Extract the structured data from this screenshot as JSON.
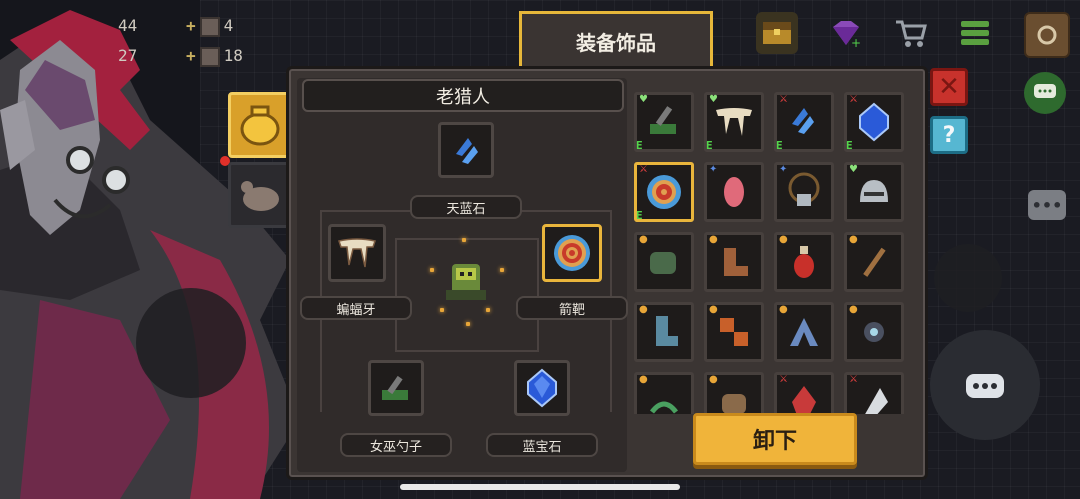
{
  "hud": {
    "stat1_value": "44",
    "stat2_value": "27",
    "plus": "+",
    "stat3_value": "4",
    "stat4_value": "18"
  },
  "header": {
    "title": "装备饰品"
  },
  "equipment": {
    "character_name": "老猎人",
    "slots": [
      {
        "label": "天蓝石",
        "icon": "azure-stone-icon"
      },
      {
        "label": "蝙蝠牙",
        "icon": "bat-fang-icon"
      },
      {
        "label": "箭靶",
        "icon": "target-icon"
      },
      {
        "label": "女巫勺子",
        "icon": "witch-spoon-icon"
      },
      {
        "label": "蓝宝石",
        "icon": "sapphire-icon"
      }
    ]
  },
  "inventory": {
    "equipped_marker": "E",
    "items": [
      {
        "icon": "witch-spoon-icon",
        "tag": "heart",
        "equipped": true
      },
      {
        "icon": "bat-fang-icon",
        "tag": "heart",
        "equipped": true
      },
      {
        "icon": "azure-stone-icon",
        "tag": "sword",
        "equipped": true
      },
      {
        "icon": "sapphire-icon",
        "tag": "sword",
        "equipped": true
      },
      {
        "icon": "target-icon",
        "tag": "sword",
        "equipped": true
      },
      {
        "icon": "pink-crystal-icon",
        "tag": "star",
        "equipped": false
      },
      {
        "icon": "skull-necklace-icon",
        "tag": "star",
        "equipped": false
      },
      {
        "icon": "spiked-helmet-icon",
        "tag": "heart",
        "equipped": false
      },
      {
        "icon": "green-claw-icon",
        "tag": "lock",
        "equipped": false
      },
      {
        "icon": "leather-boot-icon",
        "tag": "lock",
        "equipped": false
      },
      {
        "icon": "potion-icon",
        "tag": "lock",
        "equipped": false
      },
      {
        "icon": "wooden-staff-icon",
        "tag": "lock",
        "equipped": false
      },
      {
        "icon": "blue-boot-icon",
        "tag": "lock",
        "equipped": false
      },
      {
        "icon": "fire-cubes-icon",
        "tag": "lock",
        "equipped": false
      },
      {
        "icon": "steel-arch-icon",
        "tag": "lock",
        "equipped": false
      },
      {
        "icon": "gear-shard-icon",
        "tag": "lock",
        "equipped": false
      },
      {
        "icon": "green-serpent-icon",
        "tag": "lock",
        "equipped": false
      },
      {
        "icon": "leather-glove-icon",
        "tag": "lock",
        "equipped": false
      },
      {
        "icon": "red-crystal-icon",
        "tag": "sword",
        "equipped": false
      },
      {
        "icon": "white-shard-icon",
        "tag": "sword",
        "equipped": false
      }
    ]
  },
  "actions": {
    "unequip_label": "卸下",
    "help_label": "?",
    "close_label": "✕"
  },
  "colors": {
    "accent_gold": "#e9b53c",
    "button_gold": "#f0b43a",
    "panel": "#3b3533",
    "equipped_green": "#54d44c"
  }
}
